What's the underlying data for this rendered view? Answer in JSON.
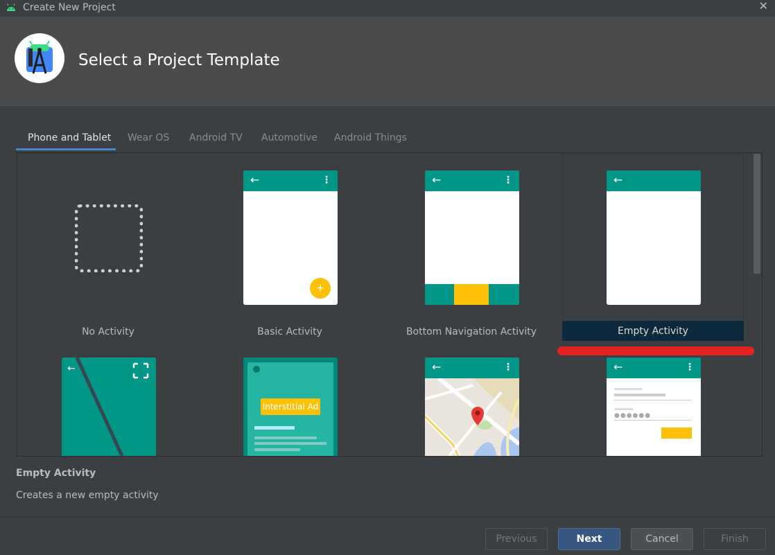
{
  "window": {
    "title": "Create New Project",
    "close_icon": "close-icon",
    "app_icon": "android-icon"
  },
  "header": {
    "title": "Select a Project Template",
    "logo_icon": "android-studio-logo"
  },
  "tabs": [
    {
      "label": "Phone and Tablet",
      "active": true
    },
    {
      "label": "Wear OS",
      "active": false
    },
    {
      "label": "Android TV",
      "active": false
    },
    {
      "label": "Automotive",
      "active": false
    },
    {
      "label": "Android Things",
      "active": false
    }
  ],
  "templates": [
    {
      "label": "No Activity",
      "selected": false
    },
    {
      "label": "Basic Activity",
      "selected": false
    },
    {
      "label": "Bottom Navigation Activity",
      "selected": false
    },
    {
      "label": "Empty Activity",
      "selected": true
    },
    {
      "label": "",
      "selected": false
    },
    {
      "label": "",
      "selected": false
    },
    {
      "label": "",
      "selected": false
    },
    {
      "label": "",
      "selected": false
    }
  ],
  "interstitial_label": "Interstitial Ad",
  "description": {
    "title": "Empty Activity",
    "text": "Creates a new empty activity"
  },
  "buttons": {
    "previous": "Previous",
    "next": "Next",
    "cancel": "Cancel",
    "finish": "Finish"
  },
  "colors": {
    "accent": "#4a88c7",
    "teal": "#009688",
    "amber": "#ffc107",
    "selection": "#0d293e",
    "highlight_mark": "#e52222"
  }
}
